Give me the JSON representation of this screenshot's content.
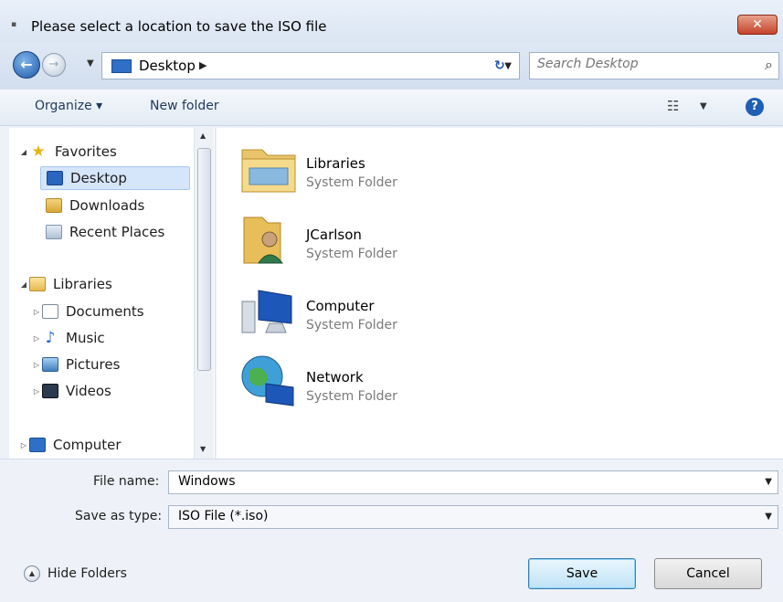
{
  "window": {
    "title": "Please select a location to save the ISO file",
    "close_label": "✕"
  },
  "address": {
    "location": "Desktop",
    "search_placeholder": "Search Desktop"
  },
  "toolbar": {
    "organize_label": "Organize ▾",
    "new_folder_label": "New folder"
  },
  "nav": {
    "favorites": "Favorites",
    "desktop": "Desktop",
    "downloads": "Downloads",
    "recent_places": "Recent Places",
    "libraries": "Libraries",
    "documents": "Documents",
    "music": "Music",
    "pictures": "Pictures",
    "videos": "Videos",
    "computer": "Computer"
  },
  "items": [
    {
      "name": "Libraries",
      "type": "System Folder",
      "icon": "libraries-folder-icon"
    },
    {
      "name": "JCarlson",
      "type": "System Folder",
      "icon": "user-folder-icon"
    },
    {
      "name": "Computer",
      "type": "System Folder",
      "icon": "computer-icon"
    },
    {
      "name": "Network",
      "type": "System Folder",
      "icon": "network-icon"
    }
  ],
  "form": {
    "file_name_label": "File name:",
    "file_name_value": "Windows",
    "save_as_type_label": "Save as type:",
    "save_as_type_value": "ISO File (*.iso)"
  },
  "footer": {
    "hide_folders_label": "Hide Folders",
    "save_label": "Save",
    "cancel_label": "Cancel"
  }
}
